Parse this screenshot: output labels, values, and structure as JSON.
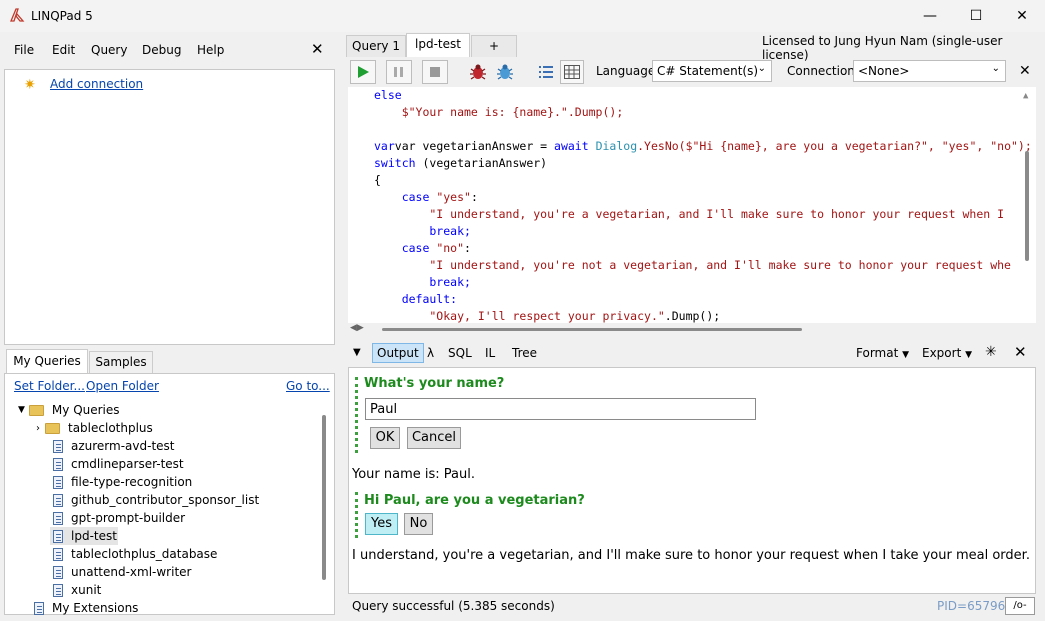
{
  "window": {
    "title": "LINQPad 5",
    "minimize": "—",
    "maximize": "☐",
    "close": "✕"
  },
  "menu": {
    "items": [
      "File",
      "Edit",
      "Query",
      "Debug",
      "Help"
    ],
    "close": "✕"
  },
  "connections": {
    "add_label": "Add connection"
  },
  "left_tabs": [
    "My Queries",
    "Samples"
  ],
  "links": {
    "set_folder": "Set Folder...",
    "open_folder": "Open Folder",
    "go_to": "Go to..."
  },
  "tree": [
    {
      "label": "My Queries",
      "type": "folder-open"
    },
    {
      "label": "tableclothplus",
      "type": "folder"
    },
    {
      "label": "azurerm-avd-test",
      "type": "doc"
    },
    {
      "label": "cmdlineparser-test",
      "type": "doc"
    },
    {
      "label": "file-type-recognition",
      "type": "doc"
    },
    {
      "label": "github_contributor_sponsor_list",
      "type": "doc"
    },
    {
      "label": "gpt-prompt-builder",
      "type": "doc"
    },
    {
      "label": "lpd-test",
      "type": "doc"
    },
    {
      "label": "tableclothplus_database",
      "type": "doc"
    },
    {
      "label": "unattend-xml-writer",
      "type": "doc"
    },
    {
      "label": "xunit",
      "type": "doc"
    },
    {
      "label": "My Extensions",
      "type": "doc"
    }
  ],
  "query_tabs": [
    "Query 1",
    "lpd-test",
    "+"
  ],
  "license": "Licensed to Jung Hyun Nam (single-user license)",
  "toolbar": {
    "language_label": "Language",
    "language_value": "C# Statement(s)",
    "connection_label": "Connection",
    "connection_value": "<None>",
    "close": "✕"
  },
  "code": {
    "l1": "else",
    "l2a": "    $\"Your name is: {name}.\".Dump();",
    "l4a": "var vegetarianAnswer = ",
    "l4b": "await ",
    "l4c": "Dialog",
    "l4d": ".YesNo($\"Hi {name}, are you a vegetarian?\", \"yes\", \"no\");",
    "l5a": "switch",
    "l5b": " (vegetarianAnswer)",
    "l6": "{",
    "l7a": "    case ",
    "l7b": "\"yes\"",
    "l7c": ":",
    "l8": "        \"I understand, you're a vegetarian, and I'll make sure to honor your request when I",
    "l9": "        break;",
    "l10a": "    case ",
    "l10b": "\"no\"",
    "l10c": ":",
    "l11": "        \"I understand, you're not a vegetarian, and I'll make sure to honor your request whe",
    "l12": "        break;",
    "l13": "    default:",
    "l14a": "        \"Okay, I'll respect your privacy.\"",
    "l14b": ".Dump();"
  },
  "output_toolbar": {
    "tabs": [
      "Output",
      "λ",
      "SQL",
      "IL",
      "Tree"
    ],
    "format": "Format",
    "export": "Export",
    "close": "✕"
  },
  "output": {
    "q1": "What's your name?",
    "input_value": "Paul",
    "ok": "OK",
    "cancel": "Cancel",
    "line1": "Your name is: Paul.",
    "q2": "Hi Paul, are you a vegetarian?",
    "yes": "Yes",
    "no": "No",
    "line2": "I understand, you're a vegetarian, and I'll make sure to honor your request when I take your meal order."
  },
  "status": {
    "text": "Query successful  (5.385 seconds)",
    "pid": "PID=65796",
    "btn": "/o-"
  },
  "colors": {
    "accent_green": "#1d8a1d",
    "keyword_blue": "#0000ff",
    "string_red": "#a31515",
    "type_teal": "#2b91af",
    "yes_button": "#bfeef5"
  }
}
